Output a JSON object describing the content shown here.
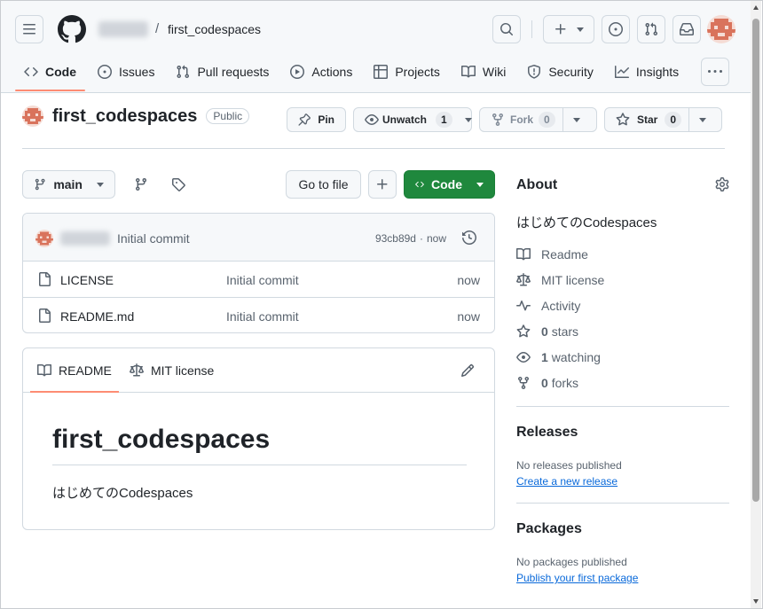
{
  "header": {
    "repo_name": "first_codespaces",
    "slash": "/"
  },
  "nav": {
    "items": [
      {
        "label": "Code",
        "icon": "code-icon"
      },
      {
        "label": "Issues",
        "icon": "issue-icon"
      },
      {
        "label": "Pull requests",
        "icon": "pull-request-icon"
      },
      {
        "label": "Actions",
        "icon": "play-icon"
      },
      {
        "label": "Projects",
        "icon": "table-icon"
      },
      {
        "label": "Wiki",
        "icon": "book-icon"
      },
      {
        "label": "Security",
        "icon": "shield-icon"
      },
      {
        "label": "Insights",
        "icon": "graph-icon"
      }
    ],
    "active": "Code"
  },
  "repo": {
    "title": "first_codespaces",
    "visibility": "Public",
    "pin_label": "Pin",
    "unwatch_label": "Unwatch",
    "watch_count": "1",
    "fork_label": "Fork",
    "fork_count": "0",
    "star_label": "Star",
    "star_count": "0"
  },
  "toolbar": {
    "branch": "main",
    "go_to_file": "Go to file",
    "code_label": "Code"
  },
  "commit": {
    "message": "Initial commit",
    "sha": "93cb89d",
    "time_sep": "·",
    "time": "now"
  },
  "files": [
    {
      "name": "LICENSE",
      "message": "Initial commit",
      "time": "now"
    },
    {
      "name": "README.md",
      "message": "Initial commit",
      "time": "now"
    }
  ],
  "readme": {
    "tab_readme": "README",
    "tab_license": "MIT license",
    "title": "first_codespaces",
    "description": "はじめてのCodespaces"
  },
  "about": {
    "heading": "About",
    "description": "はじめてのCodespaces",
    "readme": "Readme",
    "license": "MIT license",
    "activity": "Activity",
    "stars_count": "0",
    "stars_label": "stars",
    "watching_count": "1",
    "watching_label": "watching",
    "forks_count": "0",
    "forks_label": "forks"
  },
  "releases": {
    "heading": "Releases",
    "empty": "No releases published",
    "link": "Create a new release"
  },
  "packages": {
    "heading": "Packages",
    "empty": "No packages published",
    "link": "Publish your first package"
  },
  "colors": {
    "accent_green": "#1f883d",
    "nav_underline": "#fd8c73",
    "link": "#0969da"
  }
}
